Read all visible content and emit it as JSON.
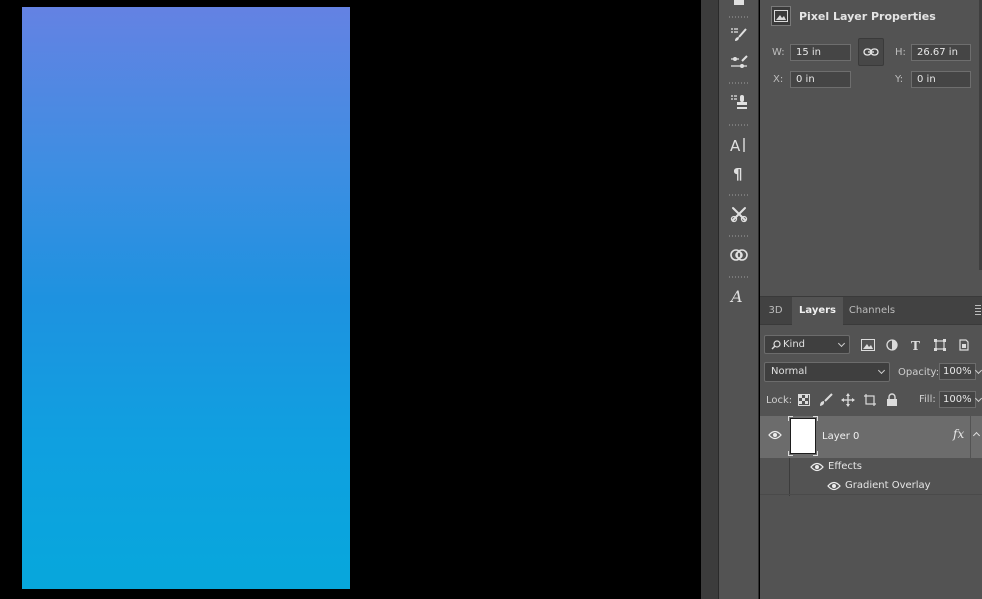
{
  "canvas": {
    "gradient_top": "#6482e3",
    "gradient_bottom": "#07a7dc"
  },
  "tool_strip": {
    "icons": [
      "brush-presets-icon",
      "brush-settings-icon",
      "clone-source-icon",
      "character-panel-icon",
      "paragraph-panel-icon",
      "tool-presets-icon",
      "creative-cloud-libraries-icon",
      "glyphs-icon"
    ]
  },
  "properties": {
    "title": "Pixel Layer Properties",
    "w_label": "W:",
    "w_value": "15 in",
    "h_label": "H:",
    "h_value": "26.67 in",
    "x_label": "X:",
    "x_value": "0 in",
    "y_label": "Y:",
    "y_value": "0 in"
  },
  "layers_panel": {
    "tabs": [
      {
        "label": "3D",
        "active": false
      },
      {
        "label": "Layers",
        "active": true
      },
      {
        "label": "Channels",
        "active": false
      }
    ],
    "filter_kind": "Kind",
    "blend_mode": "Normal",
    "opacity_label": "Opacity:",
    "opacity_value": "100%",
    "lock_label": "Lock:",
    "fill_label": "Fill:",
    "fill_value": "100%",
    "layers": [
      {
        "name": "Layer 0",
        "visible": true,
        "fx_badge": "fx",
        "effects_label": "Effects",
        "effects": [
          "Gradient Overlay"
        ]
      }
    ]
  },
  "colors": {
    "panel_bg": "#535353",
    "panel_dark": "#424242",
    "selected_layer": "#6c6c6c",
    "field_bg": "#454545"
  }
}
